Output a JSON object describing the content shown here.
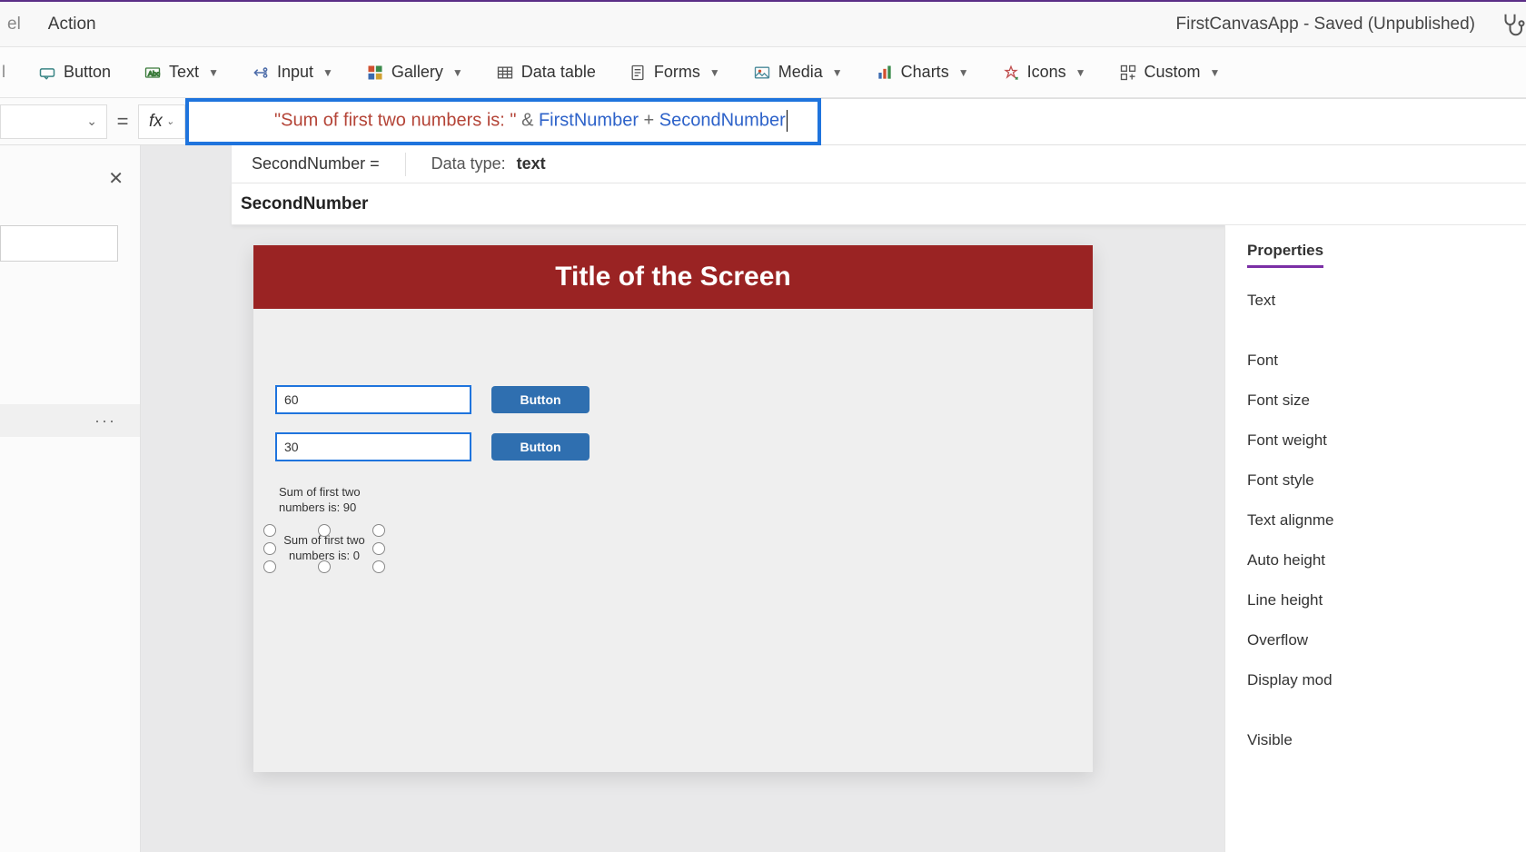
{
  "app": {
    "title": "FirstCanvasApp - Saved (Unpublished)"
  },
  "tabs": {
    "action": "Action",
    "truncated_left": "el"
  },
  "ribbon": {
    "button": "Button",
    "text": "Text",
    "input": "Input",
    "gallery": "Gallery",
    "datatable": "Data table",
    "forms": "Forms",
    "media": "Media",
    "charts": "Charts",
    "icons": "Icons",
    "custom": "Custom"
  },
  "formula": {
    "equals": "=",
    "fx": "fx",
    "string_part": "\"Sum of first two numbers is: \"",
    "amp": " & ",
    "var1": "FirstNumber",
    "plus": " + ",
    "var2": "SecondNumber"
  },
  "hint": {
    "current": "SecondNumber  =",
    "dtype_label": "Data type: ",
    "dtype_value": "text",
    "suggest": "SecondNumber"
  },
  "tree": {
    "ellipsis": "···"
  },
  "screen": {
    "title": "Title of the Screen",
    "input1": "60",
    "input2": "30",
    "button": "Button",
    "label1": "Sum of first two numbers is: 90",
    "label2": "Sum of first two numbers is: 0"
  },
  "props": {
    "header": "Properties",
    "items": [
      "Text",
      "Font",
      "Font size",
      "Font weight",
      "Font style",
      "Text alignme",
      "Auto height",
      "Line height",
      "Overflow",
      "Display mod",
      "Visible"
    ]
  }
}
